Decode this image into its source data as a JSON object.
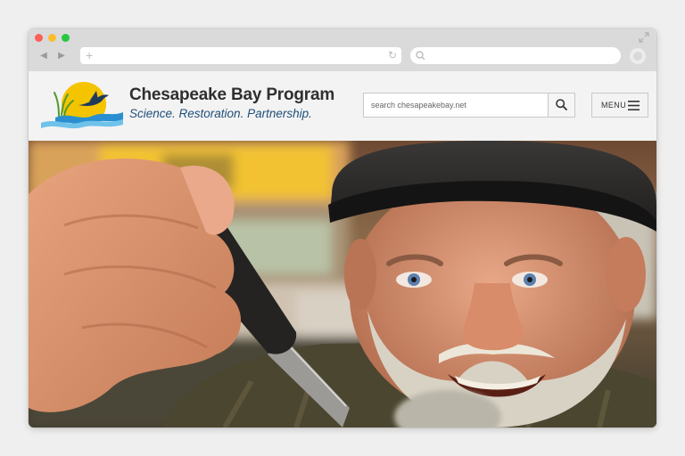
{
  "site": {
    "title": "Chesapeake Bay Program",
    "tagline": "Science. Restoration. Partnership."
  },
  "search": {
    "placeholder": "search chesapeakebay.net"
  },
  "menu": {
    "label": "MENU"
  },
  "colors": {
    "tagline": "#1f4e79",
    "logo_sun": "#f5c400",
    "logo_water": "#2a8fd0"
  },
  "icons": {
    "search": "search-icon",
    "menu": "hamburger-icon"
  }
}
